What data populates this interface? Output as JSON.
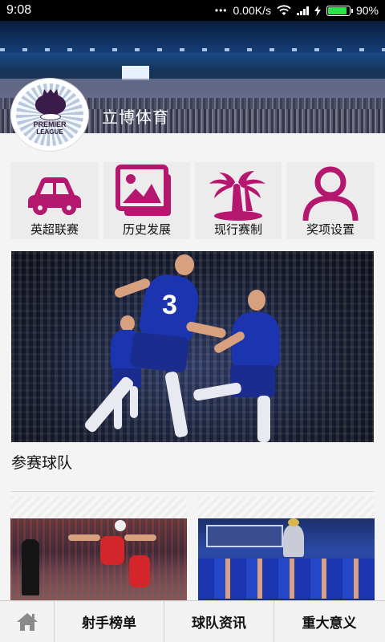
{
  "status_bar": {
    "time": "9:08",
    "dots": "•••",
    "net_speed": "0.00K/s",
    "battery_percent": "90%",
    "battery_level": 0.9,
    "icons": [
      "wifi-icon",
      "signal-icon",
      "charging-icon",
      "battery-icon"
    ]
  },
  "header": {
    "app_title": "立博体育",
    "logo": {
      "name": "premier-league-logo",
      "line1": "PREMIER",
      "line2": "LEAGUE"
    }
  },
  "menu": {
    "accent_color": "#b5166e",
    "items": [
      {
        "label": "英超联赛",
        "icon": "car-icon"
      },
      {
        "label": "历史发展",
        "icon": "gallery-icon"
      },
      {
        "label": "现行赛制",
        "icon": "palm-island-icon"
      },
      {
        "label": "奖项设置",
        "icon": "user-icon"
      }
    ]
  },
  "featured": {
    "shirt_number": "3",
    "caption": "参赛球队"
  },
  "bottom_nav": {
    "home_icon": "home-icon",
    "items": [
      "射手榜单",
      "球队资讯",
      "重大意义"
    ]
  }
}
